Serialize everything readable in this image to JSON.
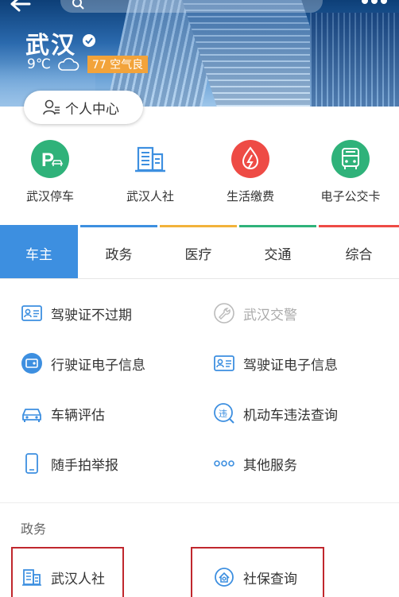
{
  "header": {
    "city": "武汉",
    "temperature": "9℃",
    "aqi": "77 空气良",
    "profile_label": "个人中心"
  },
  "shortcuts": [
    {
      "label": "武汉停车",
      "icon": "parking-icon",
      "color": "#2fb27a"
    },
    {
      "label": "武汉人社",
      "icon": "building-icon",
      "color": "#3d8fe0"
    },
    {
      "label": "生活缴费",
      "icon": "utility-payment-icon",
      "color": "#ee4b45"
    },
    {
      "label": "电子公交卡",
      "icon": "bus-card-icon",
      "color": "#2fb27a"
    }
  ],
  "tabs": [
    {
      "label": "车主",
      "color": "#3d8fe0",
      "active": true
    },
    {
      "label": "政务",
      "color": "#3d8fe0",
      "active": false
    },
    {
      "label": "医疗",
      "color": "#f2b23a",
      "active": false
    },
    {
      "label": "交通",
      "color": "#2fb27a",
      "active": false
    },
    {
      "label": "综合",
      "color": "#ee4b45",
      "active": false
    }
  ],
  "services": [
    {
      "label": "驾驶证不过期",
      "icon": "id-card-icon",
      "enabled": true
    },
    {
      "label": "武汉交警",
      "icon": "wrench-icon",
      "enabled": false
    },
    {
      "label": "行驶证电子信息",
      "icon": "license-card-icon",
      "enabled": true
    },
    {
      "label": "驾驶证电子信息",
      "icon": "id-card-icon",
      "enabled": true
    },
    {
      "label": "车辆评估",
      "icon": "car-icon",
      "enabled": true
    },
    {
      "label": "机动车违法查询",
      "icon": "violation-query-icon",
      "enabled": true
    },
    {
      "label": "随手拍举报",
      "icon": "phone-icon",
      "enabled": true
    },
    {
      "label": "其他服务",
      "icon": "more-dots-icon",
      "enabled": true
    }
  ],
  "gov_section": {
    "title": "政务",
    "items": [
      {
        "label": "武汉人社",
        "icon": "building-icon"
      },
      {
        "label": "社保查询",
        "icon": "social-security-icon"
      }
    ]
  },
  "colors": {
    "accent_blue": "#3d8fe0",
    "highlight_red": "#c0272d",
    "aqi_orange": "#f2a33a"
  }
}
